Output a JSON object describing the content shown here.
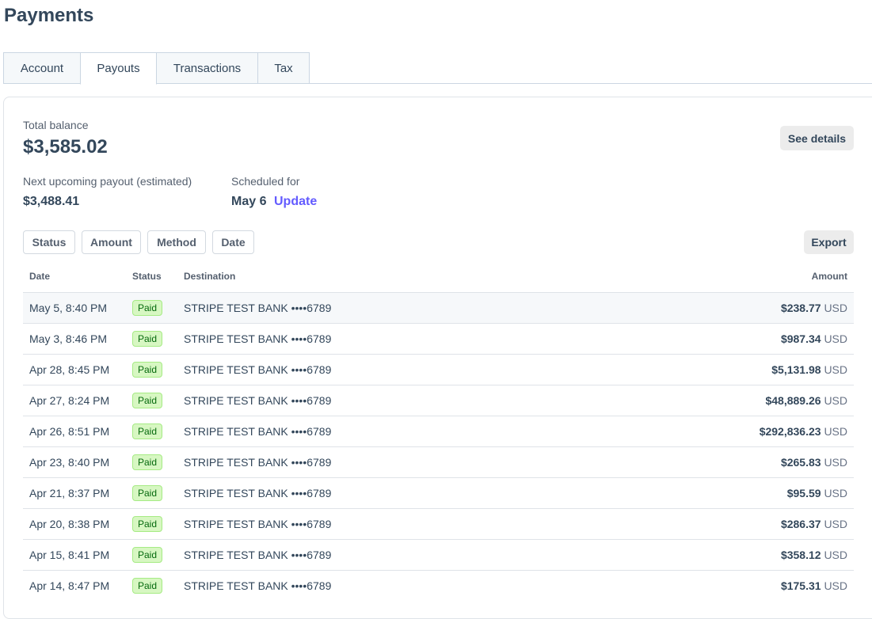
{
  "page": {
    "title": "Payments"
  },
  "tabs": [
    {
      "label": "Account"
    },
    {
      "label": "Payouts"
    },
    {
      "label": "Transactions"
    },
    {
      "label": "Tax"
    }
  ],
  "balance": {
    "total_label": "Total balance",
    "total_value": "$3,585.02",
    "see_details": "See details",
    "next_label": "Next upcoming payout (estimated)",
    "next_value": "$3,488.41",
    "scheduled_label": "Scheduled for",
    "scheduled_value": "May 6",
    "update_link": "Update"
  },
  "filters": {
    "status": "Status",
    "amount": "Amount",
    "method": "Method",
    "date": "Date",
    "export": "Export"
  },
  "table": {
    "headers": {
      "date": "Date",
      "status": "Status",
      "destination": "Destination",
      "amount": "Amount"
    },
    "rows": [
      {
        "date": "May 5, 8:40 PM",
        "status": "Paid",
        "destination": "STRIPE TEST BANK ••••6789",
        "amount": "$238.77",
        "currency": "USD"
      },
      {
        "date": "May 3, 8:46 PM",
        "status": "Paid",
        "destination": "STRIPE TEST BANK ••••6789",
        "amount": "$987.34",
        "currency": "USD"
      },
      {
        "date": "Apr 28, 8:45 PM",
        "status": "Paid",
        "destination": "STRIPE TEST BANK ••••6789",
        "amount": "$5,131.98",
        "currency": "USD"
      },
      {
        "date": "Apr 27, 8:24 PM",
        "status": "Paid",
        "destination": "STRIPE TEST BANK ••••6789",
        "amount": "$48,889.26",
        "currency": "USD"
      },
      {
        "date": "Apr 26, 8:51 PM",
        "status": "Paid",
        "destination": "STRIPE TEST BANK ••••6789",
        "amount": "$292,836.23",
        "currency": "USD"
      },
      {
        "date": "Apr 23, 8:40 PM",
        "status": "Paid",
        "destination": "STRIPE TEST BANK ••••6789",
        "amount": "$265.83",
        "currency": "USD"
      },
      {
        "date": "Apr 21, 8:37 PM",
        "status": "Paid",
        "destination": "STRIPE TEST BANK ••••6789",
        "amount": "$95.59",
        "currency": "USD"
      },
      {
        "date": "Apr 20, 8:38 PM",
        "status": "Paid",
        "destination": "STRIPE TEST BANK ••••6789",
        "amount": "$286.37",
        "currency": "USD"
      },
      {
        "date": "Apr 15, 8:41 PM",
        "status": "Paid",
        "destination": "STRIPE TEST BANK ••••6789",
        "amount": "$358.12",
        "currency": "USD"
      },
      {
        "date": "Apr 14, 8:47 PM",
        "status": "Paid",
        "destination": "STRIPE TEST BANK ••••6789",
        "amount": "$175.31",
        "currency": "USD"
      }
    ]
  }
}
